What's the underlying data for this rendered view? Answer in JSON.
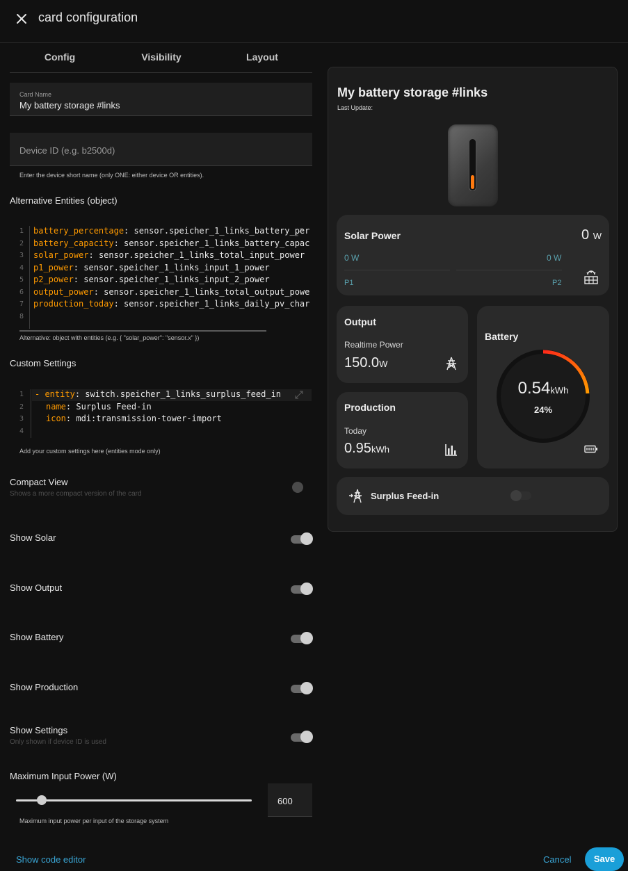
{
  "dialog": {
    "title": "card configuration",
    "tabs": [
      "Config",
      "Visibility",
      "Layout"
    ]
  },
  "form": {
    "card_name": {
      "label": "Card Name",
      "value": "My battery storage #links"
    },
    "device_id": {
      "placeholder": "Device ID (e.g. b2500d)",
      "helper": "Enter the device short name (only ONE: either device OR entities)."
    },
    "alt_entities": {
      "title": "Alternative Entities (object)",
      "lines": [
        {
          "num": "1",
          "key": "battery_percentage",
          "value": " sensor.speicher_1_links_battery_per"
        },
        {
          "num": "2",
          "key": "battery_capacity",
          "value": " sensor.speicher_1_links_battery_capac"
        },
        {
          "num": "3",
          "key": "solar_power",
          "value": " sensor.speicher_1_links_total_input_power"
        },
        {
          "num": "4",
          "key": "p1_power",
          "value": " sensor.speicher_1_links_input_1_power"
        },
        {
          "num": "5",
          "key": "p2_power",
          "value": " sensor.speicher_1_links_input_2_power"
        },
        {
          "num": "6",
          "key": "output_power",
          "value": " sensor.speicher_1_links_total_output_powe"
        },
        {
          "num": "7",
          "key": "production_today",
          "value": " sensor.speicher_1_links_daily_pv_char"
        },
        {
          "num": "8",
          "key": "",
          "value": ""
        }
      ],
      "helper": "Alternative: object with entities (e.g. { \"solar_power\": \"sensor.x\" })"
    },
    "custom_settings": {
      "title": "Custom Settings",
      "lines": [
        {
          "num": "1",
          "dash": "- ",
          "key": "entity",
          "value": " switch.speicher_1_links_surplus_feed_in"
        },
        {
          "num": "2",
          "dash": "",
          "key": "name",
          "value": " Surplus Feed-in"
        },
        {
          "num": "3",
          "dash": "",
          "key": "icon",
          "value": " mdi:transmission-tower-import"
        },
        {
          "num": "4",
          "dash": "",
          "key": "",
          "value": ""
        }
      ],
      "helper": "Add your custom settings here (entities mode only)"
    },
    "toggles": {
      "compact": {
        "label": "Compact View",
        "sub": "Shows a more compact version of the card",
        "on": false
      },
      "solar": {
        "label": "Show Solar",
        "on": true
      },
      "output": {
        "label": "Show Output",
        "on": true
      },
      "battery": {
        "label": "Show Battery",
        "on": true
      },
      "production": {
        "label": "Show Production",
        "on": true
      },
      "settings": {
        "label": "Show Settings",
        "sub": "Only shown if device ID is used",
        "on": true
      }
    },
    "max_input": {
      "title": "Maximum Input Power (W)",
      "value": "600",
      "slider_fraction": 0.11,
      "helper": "Maximum input power per input of the storage system"
    }
  },
  "footer": {
    "code_editor": "Show code editor",
    "cancel": "Cancel",
    "save": "Save"
  },
  "preview": {
    "title": "My battery storage #links",
    "last_update": "Last Update:",
    "solar": {
      "title": "Solar Power",
      "value": "0",
      "unit": "W",
      "p1_value": "0 W",
      "p2_value": "0 W",
      "p1_label": "P1",
      "p2_label": "P2"
    },
    "output": {
      "title": "Output",
      "sub": "Realtime Power",
      "value": "150.0",
      "unit": "W"
    },
    "production": {
      "title": "Production",
      "sub": "Today",
      "value": "0.95",
      "unit": "kWh"
    },
    "battery": {
      "title": "Battery",
      "value": "0.54",
      "unit": "kWh",
      "percent": "24%",
      "percent_value": 24
    },
    "surplus": {
      "label": "Surplus Feed-in",
      "on": false
    },
    "colors": {
      "accent": "#1a9fd8",
      "battery_ring_start": "#ff2a1a",
      "battery_ring_end": "#ff9a00",
      "link": "#3aa6d6"
    }
  }
}
